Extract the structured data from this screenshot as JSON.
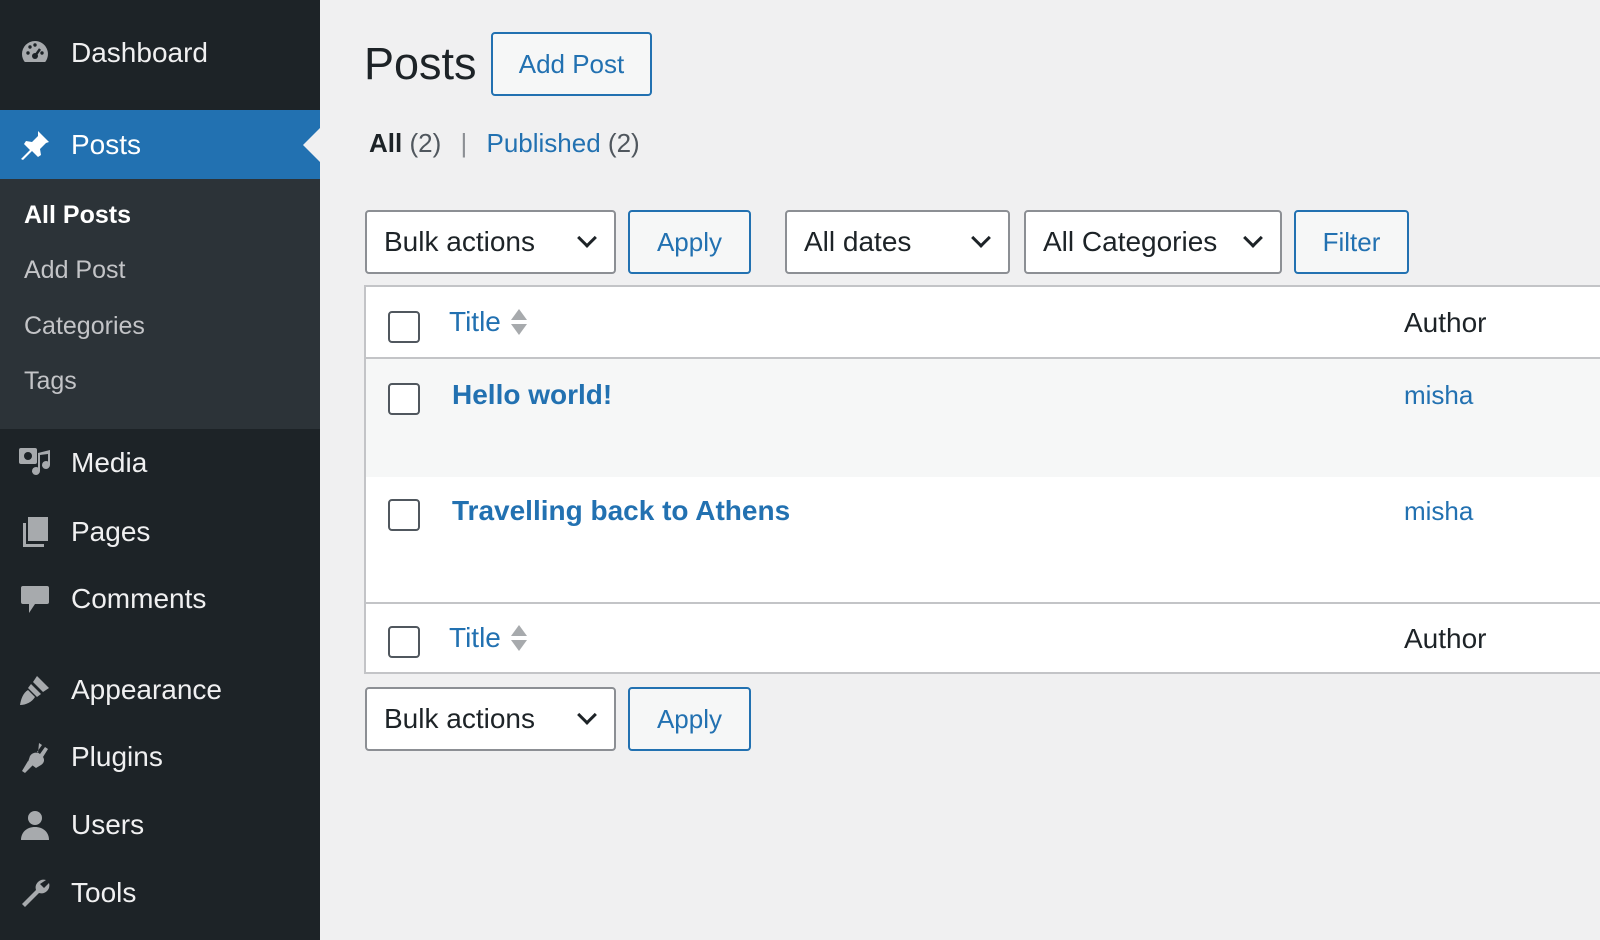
{
  "sidebar": {
    "menu": [
      {
        "label": "Dashboard",
        "icon": "dashboard-icon"
      },
      {
        "label": "Posts",
        "icon": "pin-icon"
      },
      {
        "label": "Media",
        "icon": "media-icon"
      },
      {
        "label": "Pages",
        "icon": "pages-icon"
      },
      {
        "label": "Comments",
        "icon": "comment-icon"
      },
      {
        "label": "Appearance",
        "icon": "paintbrush-icon"
      },
      {
        "label": "Plugins",
        "icon": "plugin-icon"
      },
      {
        "label": "Users",
        "icon": "user-icon"
      },
      {
        "label": "Tools",
        "icon": "wrench-icon"
      }
    ],
    "submenu": [
      "All Posts",
      "Add Post",
      "Categories",
      "Tags"
    ]
  },
  "page": {
    "title": "Posts",
    "add_button": "Add Post"
  },
  "views": {
    "all_label": "All",
    "all_count": "(2)",
    "separator": "|",
    "published_label": "Published",
    "published_count": "(2)"
  },
  "filters": {
    "bulk_actions": "Bulk actions",
    "apply": "Apply",
    "dates": "All dates",
    "categories": "All Categories",
    "filter_button": "Filter"
  },
  "table": {
    "columns": {
      "title": "Title",
      "author": "Author"
    },
    "rows": [
      {
        "title": "Hello world!",
        "author": "misha"
      },
      {
        "title": "Travelling back to Athens",
        "author": "misha"
      }
    ]
  },
  "colors": {
    "sidebar_bg": "#1d2327",
    "accent": "#2271b1",
    "page_bg": "#f0f0f1"
  }
}
